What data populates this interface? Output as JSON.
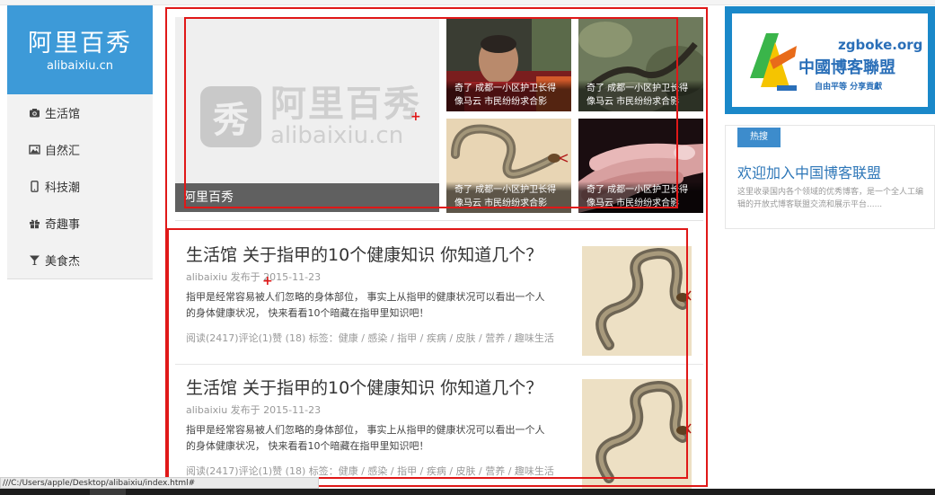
{
  "logo": {
    "title": "阿里百秀",
    "subtitle": "alibaixiu.cn"
  },
  "nav": [
    {
      "label": "生活馆",
      "icon": "camera-icon"
    },
    {
      "label": "自然汇",
      "icon": "picture-icon"
    },
    {
      "label": "科技潮",
      "icon": "phone-icon"
    },
    {
      "label": "奇趣事",
      "icon": "gift-icon"
    },
    {
      "label": "美食杰",
      "icon": "cocktail-icon"
    }
  ],
  "featured": {
    "caption": "阿里百秀",
    "watermark_cn": "阿里百秀",
    "watermark_en": "alibaixiu.cn",
    "watermark_badge": "秀"
  },
  "thumbs": [
    {
      "caption": "奇了 成都一小区护卫长得像马云 市民纷纷求合影"
    },
    {
      "caption": "奇了 成都一小区护卫长得像马云 市民纷纷求合影"
    },
    {
      "caption": "奇了 成都一小区护卫长得像马云 市民纷纷求合影"
    },
    {
      "caption": "奇了 成都一小区护卫长得像马云 市民纷纷求合影"
    }
  ],
  "articles": [
    {
      "title": "生活馆 关于指甲的10个健康知识 你知道几个？",
      "meta": "alibaixiu 发布于 2015-11-23",
      "excerpt": "指甲是经常容易被人们忽略的身体部位， 事实上从指甲的健康状况可以看出一个人的身体健康状况， 快来看看10个暗藏在指甲里知识吧！",
      "footer": "阅读(2417)评论(1)赞 (18) 标签：健康 / 感染 / 指甲 / 疾病 / 皮肤 / 营养 / 趣味生活"
    },
    {
      "title": "生活馆 关于指甲的10个健康知识 你知道几个？",
      "meta": "alibaixiu 发布于 2015-11-23",
      "excerpt": "指甲是经常容易被人们忽略的身体部位， 事实上从指甲的健康状况可以看出一个人的身体健康状况， 快来看看10个暗藏在指甲里知识吧！",
      "footer": "阅读(2417)评论(1)赞 (18) 标签：健康 / 感染 / 指甲 / 疾病 / 皮肤 / 营养 / 趣味生活"
    }
  ],
  "banner": {
    "domain": "zgboke.org",
    "name": "中國博客聯盟",
    "slogan": "自由平等  分享貢獻"
  },
  "hot": {
    "badge": "热搜",
    "title": "欢迎加入中国博客联盟",
    "desc": "这里收录国内各个领域的优秀博客，是一个全人工编辑的开放式博客联盟交流和展示平台......"
  },
  "status_url": "///C:/Users/apple/Desktop/alibaixiu/index.html#",
  "colors": {
    "brand_blue": "#3d9ad8",
    "annotation_red": "#e01818",
    "link_blue": "#2e77b8"
  }
}
